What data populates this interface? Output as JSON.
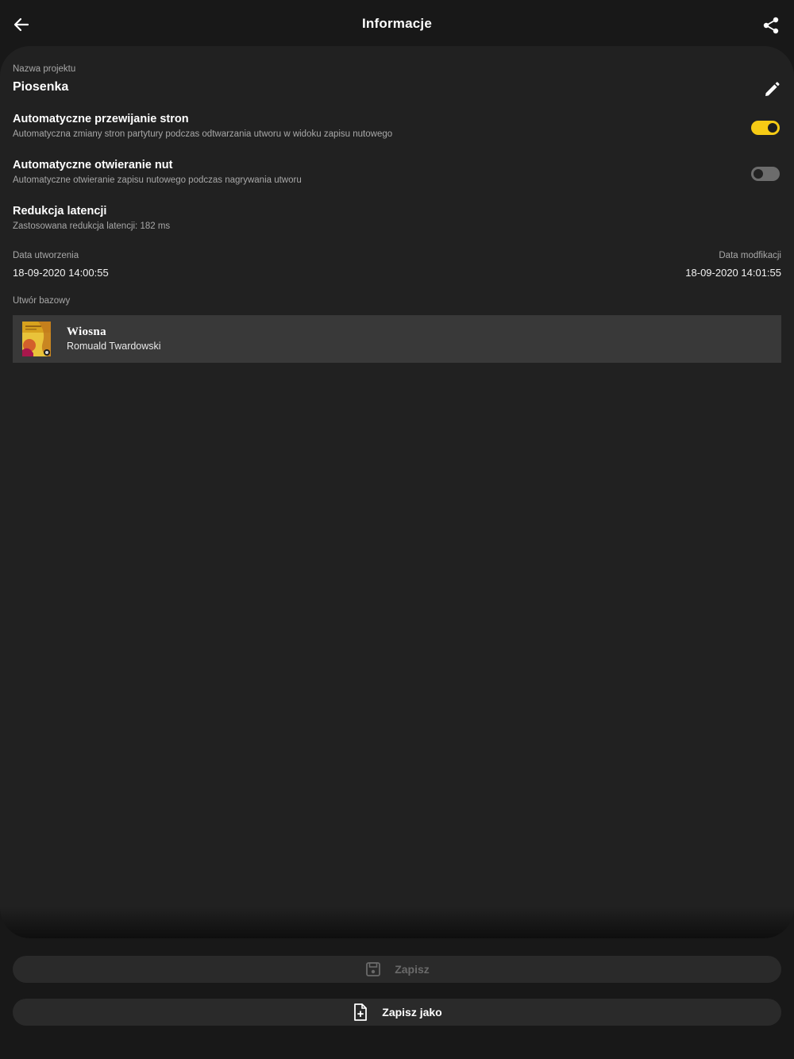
{
  "header": {
    "title": "Informacje",
    "back_icon": "arrow-left-icon",
    "share_icon": "share-icon"
  },
  "project": {
    "name_label": "Nazwa projektu",
    "name": "Piosenka",
    "edit_icon": "pencil-icon"
  },
  "settings": [
    {
      "title": "Automatyczne przewijanie stron",
      "description": "Automatyczna zmiany stron partytury podczas odtwarzania utworu w widoku zapisu nutowego",
      "enabled": true
    },
    {
      "title": "Automatyczne otwieranie nut",
      "description": "Automatyczne otwieranie zapisu nutowego podczas nagrywania utworu",
      "enabled": false
    },
    {
      "title": "Redukcja latencji",
      "description": "Zastosowana redukcja latencji: 182 ms"
    }
  ],
  "dates": {
    "created_label": "Data utworzenia",
    "created": "18-09-2020 14:00:55",
    "modified_label": "Data modfikacji",
    "modified": "18-09-2020 14:01:55"
  },
  "base_track": {
    "label": "Utwór bazowy",
    "title": "Wiosna",
    "artist": "Romuald Twardowski"
  },
  "buttons": {
    "save": "Zapisz",
    "save_as": "Zapisz jako"
  },
  "colors": {
    "accent": "#f6cb15",
    "background": "#181818",
    "card": "#212121"
  }
}
